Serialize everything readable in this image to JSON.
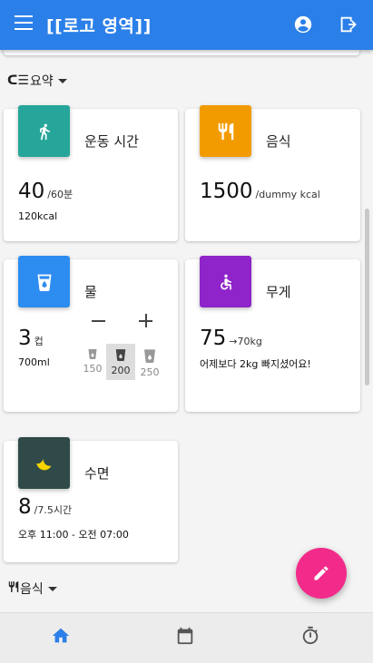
{
  "app": {
    "title": "[[로고 영역]]"
  },
  "icons": {
    "menu": "menu-icon",
    "account": "account-circle-icon",
    "logout": "logout-icon",
    "walk": "walk-icon",
    "food": "restaurant-icon",
    "water": "water-cup-icon",
    "weight": "accessible-icon",
    "sleep": "moon-icon",
    "edit": "pencil-icon",
    "home": "home-icon",
    "calendar": "calendar-icon",
    "timer": "timer-icon"
  },
  "colors": {
    "appbar": "#2b7fe8",
    "exercise": "#26a69a",
    "food": "#f29b00",
    "water": "#2d8cf0",
    "weight": "#8e24c9",
    "sleep": "#2f4a48",
    "fab": "#f22b8a",
    "nav_active": "#2b7fe8"
  },
  "summary": {
    "glyph": "ᑕ☰",
    "label": "요약"
  },
  "cards": {
    "exercise": {
      "title": "운동 시간",
      "value": "40",
      "unit": "/60분",
      "sub": "120kcal"
    },
    "food": {
      "title": "음식",
      "value": "1500",
      "unit": "/dummy kcal"
    },
    "water": {
      "title": "물",
      "value": "3",
      "unit": "컵",
      "sub": "700ml",
      "options": [
        {
          "amount": "150",
          "selected": false
        },
        {
          "amount": "200",
          "selected": true
        },
        {
          "amount": "250",
          "selected": false
        }
      ]
    },
    "weight": {
      "title": "무게",
      "value": "75",
      "unit": "→70kg",
      "sub": "어제보다 2kg 빠지셨어요!"
    },
    "sleep": {
      "title": "수면",
      "value": "8",
      "unit": "/7.5시간",
      "sub": "오후 11:00 - 오전 07:00"
    }
  },
  "food_section": {
    "label": "음식"
  },
  "bottom_nav": {
    "active": "home"
  }
}
